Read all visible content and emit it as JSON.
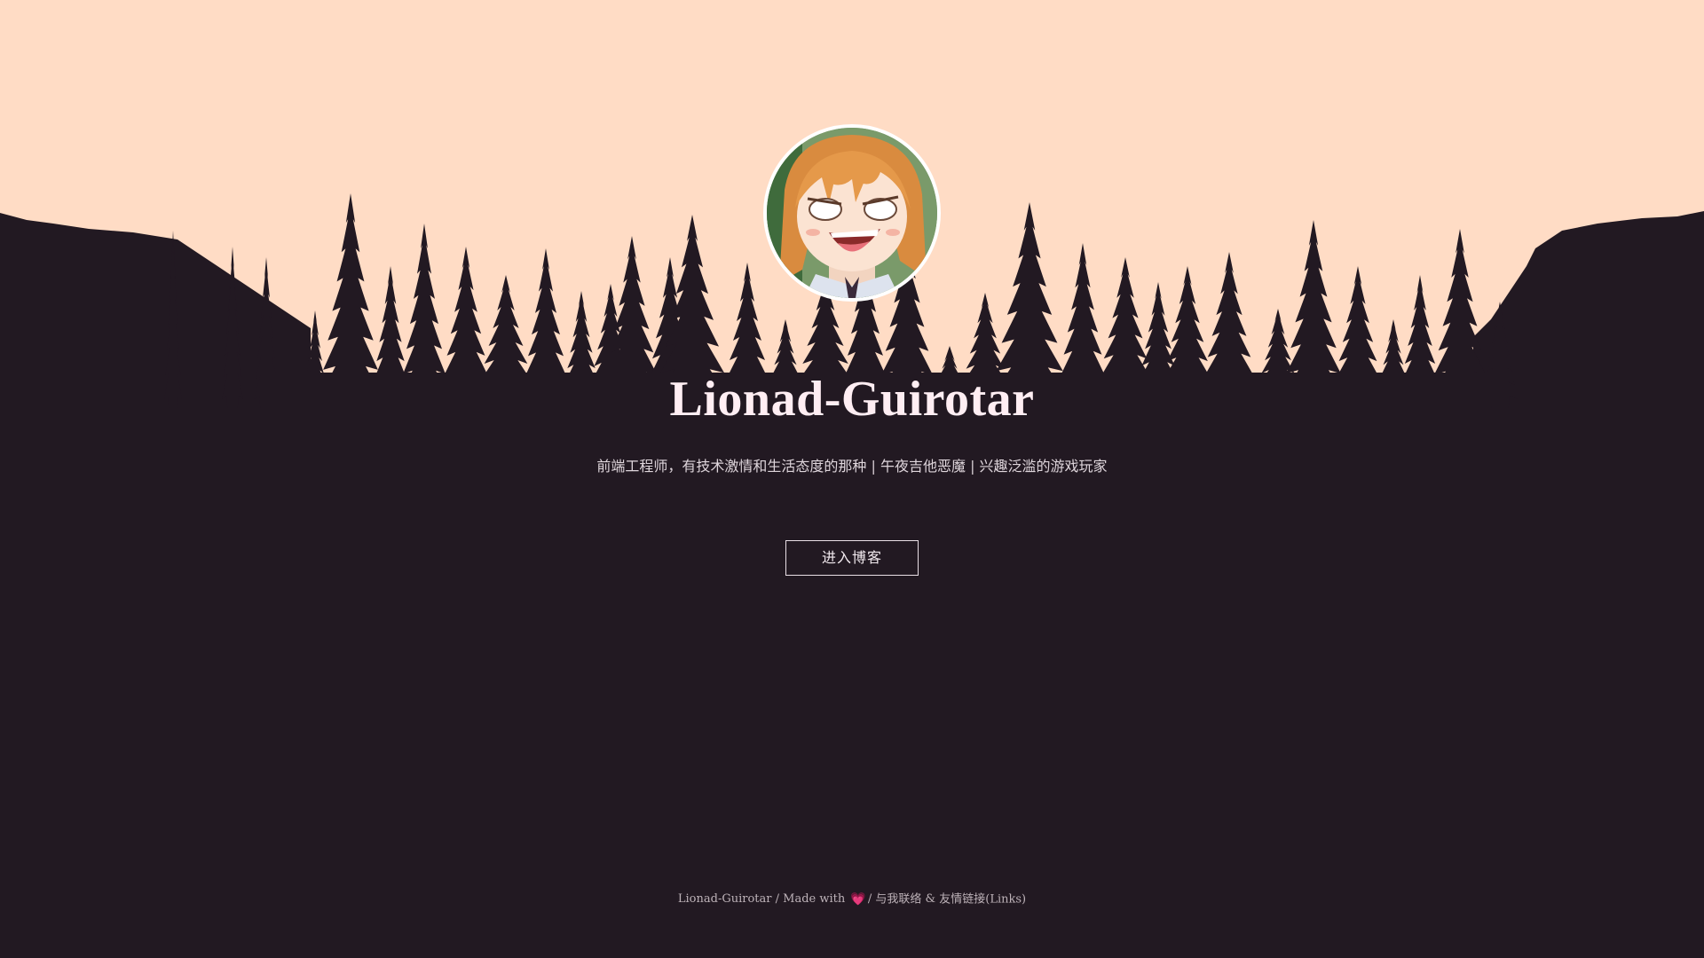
{
  "profile": {
    "name": "Lionad-Guirotar",
    "tagline": "前端工程师，有技术激情和生活态度的那种 | 午夜吉他恶魔 | 兴趣泛滥的游戏玩家",
    "avatar_icon": "anime-girl-avatar"
  },
  "actions": {
    "enter_blog_label": "进入博客"
  },
  "footer": {
    "author": "Lionad-Guirotar",
    "separator_1": "/",
    "made_with": "Made with",
    "heart_icon": "heart-icon",
    "separator_2": "/",
    "contact_label": "与我联络",
    "ampersand": "&",
    "links_label": "友情链接(Links)"
  },
  "colors": {
    "sky": "#ffdcc5",
    "silhouette": "#221922",
    "title": "#ffeef3",
    "heart": "#ff5aa0"
  }
}
